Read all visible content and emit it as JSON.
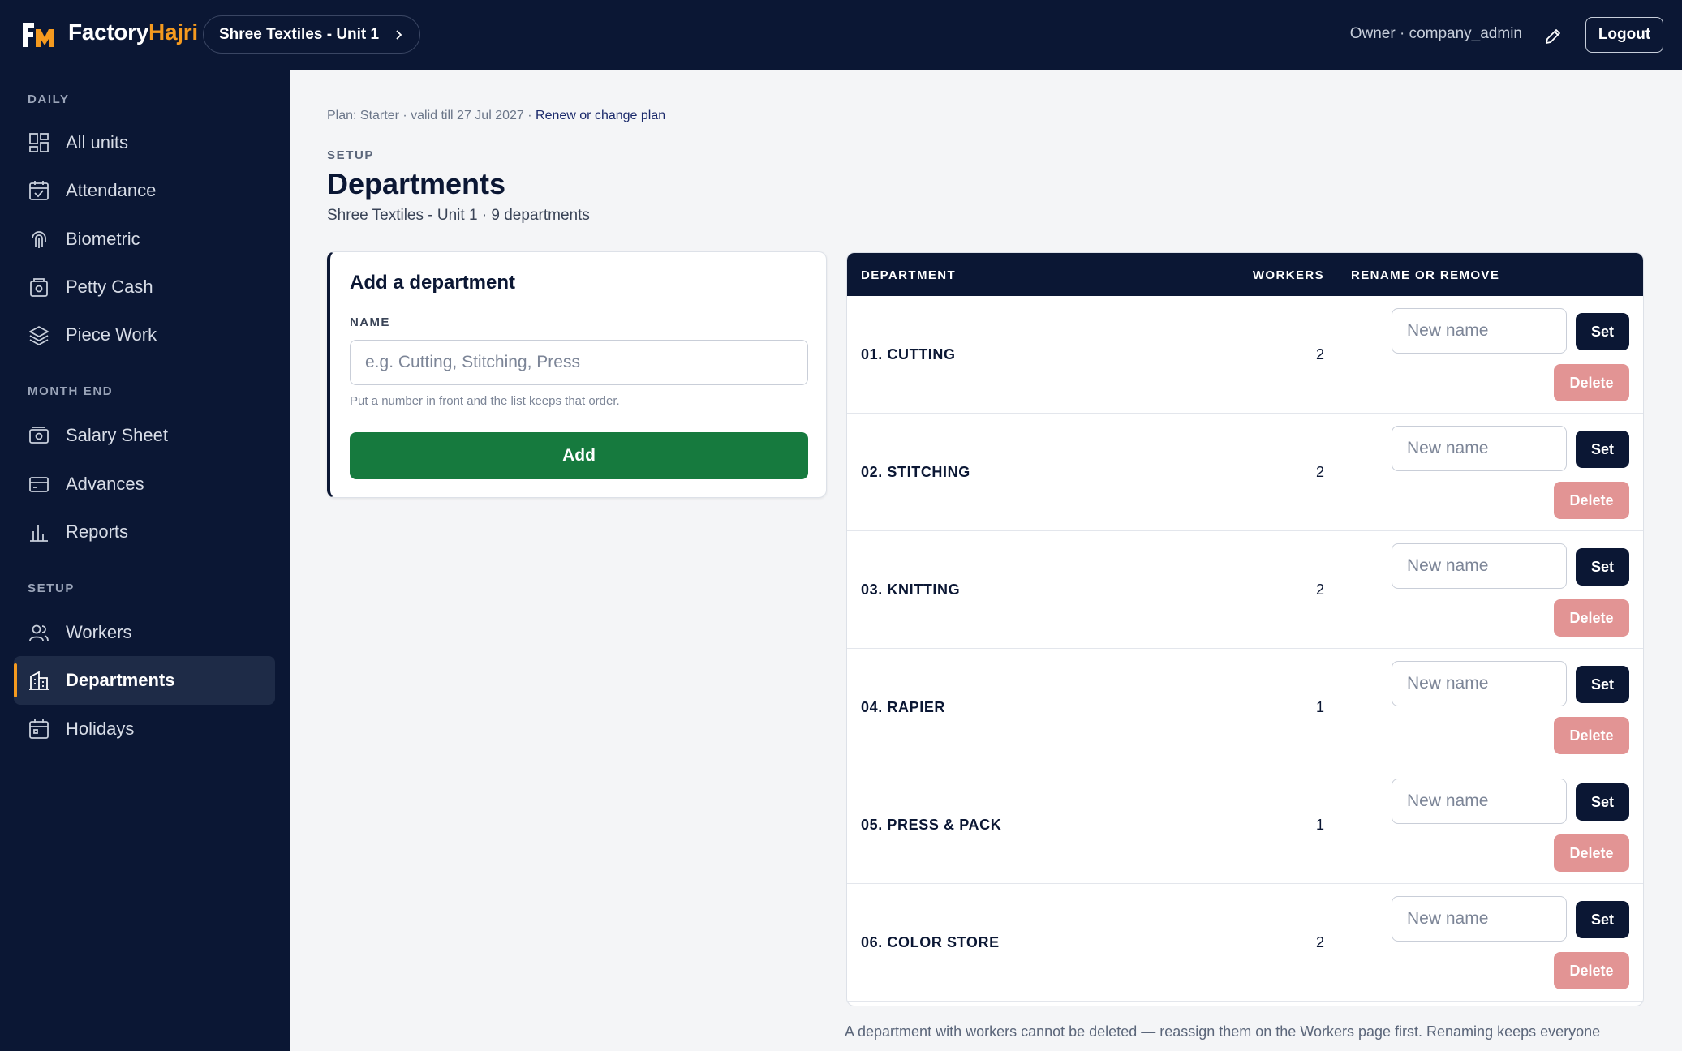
{
  "topbar": {
    "brand_primary": "Factory",
    "brand_accent": "Hajri",
    "unit_selector": "Shree Textiles - Unit 1",
    "user_role": "Owner · company_admin",
    "logout_label": "Logout"
  },
  "colors": {
    "navy": "#0b1734",
    "accent_orange": "#f59a1f",
    "add_green": "#167a3e",
    "delete_red": "#e29494"
  },
  "sidebar": {
    "daily_heading": "DAILY",
    "month_end_heading": "MONTH END",
    "setup_heading": "SETUP",
    "items": [
      {
        "label": "All units",
        "icon": "grid-icon"
      },
      {
        "label": "Attendance",
        "icon": "calendar-check-icon"
      },
      {
        "label": "Biometric",
        "icon": "fingerprint-icon"
      },
      {
        "label": "Petty Cash",
        "icon": "cash-box-icon"
      },
      {
        "label": "Piece Work",
        "icon": "layers-icon"
      },
      {
        "label": "Salary Sheet",
        "icon": "banknote-icon"
      },
      {
        "label": "Advances",
        "icon": "credit-card-icon"
      },
      {
        "label": "Reports",
        "icon": "bar-chart-icon"
      },
      {
        "label": "Workers",
        "icon": "users-icon"
      },
      {
        "label": "Departments",
        "icon": "building-icon",
        "active": true
      },
      {
        "label": "Holidays",
        "icon": "calendar-icon"
      }
    ]
  },
  "main": {
    "plan_text": "Plan: Starter · valid till 27 Jul 2027 · ",
    "plan_link": "Renew or change plan",
    "eyebrow": "SETUP",
    "title": "Departments",
    "subtitle": "Shree Textiles - Unit 1 · 9 departments",
    "add_card": {
      "heading": "Add a department",
      "name_label": "NAME",
      "name_value": "",
      "name_placeholder": "e.g. Cutting, Stitching, Press",
      "hint": "Put a number in front and the list keeps that order.",
      "add_label": "Add"
    },
    "table": {
      "headers": {
        "department": "DEPARTMENT",
        "workers": "WORKERS",
        "actions": "RENAME OR REMOVE"
      },
      "rename_placeholder": "New name",
      "set_label": "Set",
      "delete_label": "Delete",
      "rows": [
        {
          "name": "01. CUTTING",
          "workers": "2"
        },
        {
          "name": "02. STITCHING",
          "workers": "2"
        },
        {
          "name": "03. KNITTING",
          "workers": "2"
        },
        {
          "name": "04. RAPIER",
          "workers": "1"
        },
        {
          "name": "05. PRESS & PACK",
          "workers": "1"
        },
        {
          "name": "06. COLOR STORE",
          "workers": "2"
        }
      ]
    },
    "footnote": "A department with workers cannot be deleted — reassign them on the Workers page first. Renaming keeps everyone"
  }
}
